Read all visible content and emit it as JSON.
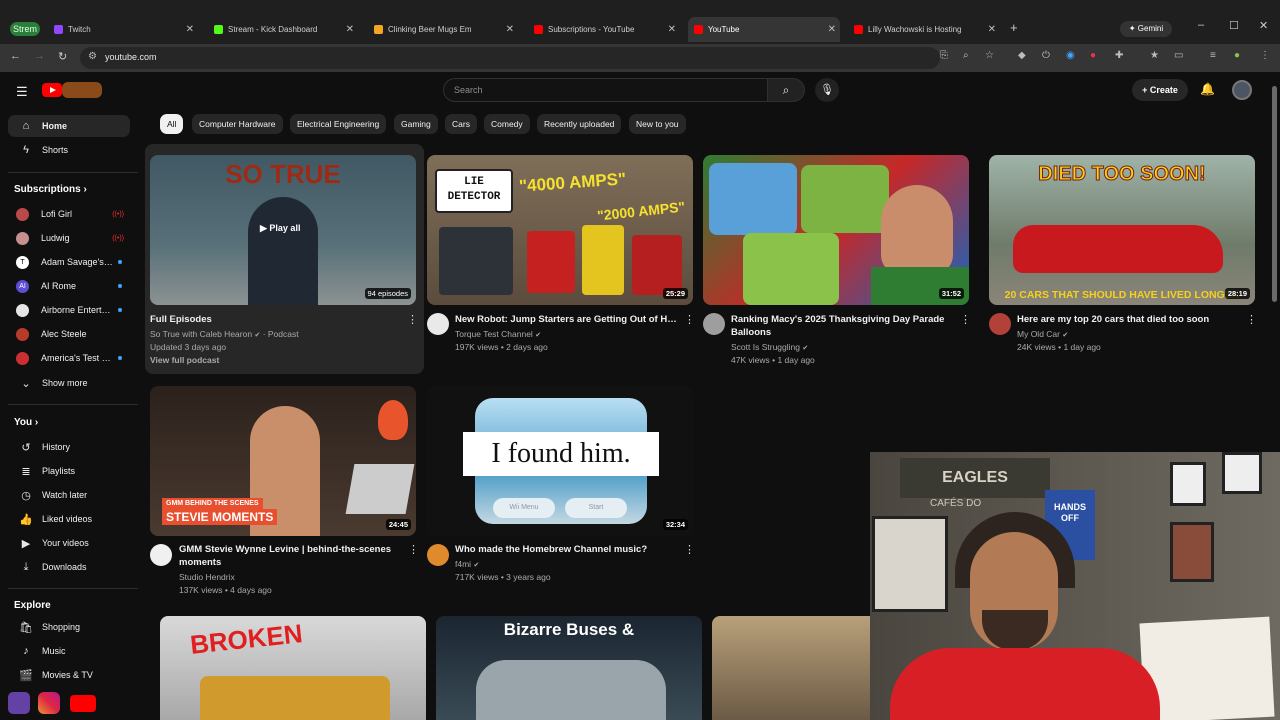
{
  "browser": {
    "stream_pill": "Strem",
    "tabs": [
      {
        "title": "Twitch",
        "favicon_color": "#9146ff"
      },
      {
        "title": "Stream - Kick Dashboard",
        "favicon_color": "#53fc18"
      },
      {
        "title": "Clinking Beer Mugs Em",
        "favicon_color": "#f6a623"
      },
      {
        "title": "Subscriptions - YouTube",
        "favicon_color": "#ff0000"
      },
      {
        "title": "YouTube",
        "favicon_color": "#ff0000",
        "active": true
      },
      {
        "title": "Lilly Wachowski is Hosting",
        "favicon_color": "#ff0000"
      }
    ],
    "gemini_label": "Gemini",
    "url": "youtube.com"
  },
  "header": {
    "search_placeholder": "Search",
    "create_label": "Create"
  },
  "sidebar": {
    "main": [
      {
        "label": "Home",
        "icon": "home-icon",
        "active": true
      },
      {
        "label": "Shorts",
        "icon": "shorts-icon"
      }
    ],
    "subscriptions_title": "Subscriptions",
    "subscriptions": [
      {
        "label": "Lofi Girl",
        "avatar_color": "#b94a48",
        "status": "live"
      },
      {
        "label": "Ludwig",
        "avatar_color": "#c88f8f",
        "status": "live"
      },
      {
        "label": "Adam Savage's T...",
        "avatar_color": "#ffffff",
        "avatar_letter": "T",
        "status": "new"
      },
      {
        "label": "AI Rome",
        "avatar_color": "#5b4fd6",
        "avatar_letter": "AI",
        "status": "new"
      },
      {
        "label": "Airborne Entertai...",
        "avatar_color": "#e5e5e5",
        "status": "new"
      },
      {
        "label": "Alec Steele",
        "avatar_color": "#b83a2b",
        "status": "none"
      },
      {
        "label": "America's Test Ki...",
        "avatar_color": "#cc2f2f",
        "status": "new"
      }
    ],
    "show_more": "Show more",
    "you_title": "You",
    "you_items": [
      {
        "label": "History",
        "icon": "history-icon"
      },
      {
        "label": "Playlists",
        "icon": "playlists-icon"
      },
      {
        "label": "Watch later",
        "icon": "watch-later-icon"
      },
      {
        "label": "Liked videos",
        "icon": "liked-icon"
      },
      {
        "label": "Your videos",
        "icon": "your-videos-icon"
      },
      {
        "label": "Downloads",
        "icon": "downloads-icon"
      }
    ],
    "explore_title": "Explore",
    "explore_items": [
      {
        "label": "Shopping",
        "icon": "shopping-icon"
      },
      {
        "label": "Music",
        "icon": "music-icon"
      },
      {
        "label": "Movies & TV",
        "icon": "movies-icon"
      }
    ]
  },
  "chips": [
    "All",
    "Computer Hardware",
    "Electrical Engineering",
    "Gaming",
    "Cars",
    "Comedy",
    "Recently uploaded",
    "New to you"
  ],
  "videos": [
    {
      "thumb_text": "SO TRUE",
      "overlay": "Play all",
      "episodes": "94 episodes",
      "title": "Full Episodes",
      "channel": "So True with Caleb Hearon",
      "channel_suffix": "· Podcast",
      "meta": "Updated 3 days ago",
      "extra": "View full podcast"
    },
    {
      "thumb_text_1": "LIE DETECTOR",
      "thumb_text_2": "\"4000 AMPS\"",
      "thumb_text_3": "\"2000 AMPS\"",
      "duration": "25:29",
      "title": "New Robot: Jump Starters are Getting Out of Hand",
      "channel": "Torque Test Channel",
      "meta": "197K views • 2 days ago"
    },
    {
      "duration": "31:52",
      "title": "Ranking Macy's 2025 Thanksgiving Day Parade Balloons",
      "channel": "Scott Is Struggling",
      "meta": "47K views • 1 day ago"
    },
    {
      "thumb_text_1": "DIED TOO SOON!",
      "thumb_text_2": "20 CARS THAT SHOULD HAVE LIVED LONGER",
      "duration": "28:19",
      "title": "Here are my top 20 cars that died too soon",
      "channel": "My Old Car",
      "meta": "24K views • 1 day ago"
    },
    {
      "thumb_text_1": "GMM BEHIND THE SCENES",
      "thumb_text_2": "STEVIE MOMENTS",
      "duration": "24:45",
      "title": "GMM Stevie Wynne Levine | behind-the-scenes moments",
      "channel": "Studio Hendrix",
      "meta": "137K views • 4 days ago"
    },
    {
      "thumb_text": "I found him.",
      "thumb_btn_1": "Wii Menu",
      "thumb_btn_2": "Start",
      "duration": "32:34",
      "title": "Who made the Homebrew Channel music?",
      "channel": "f4mi",
      "meta": "717K views • 3 years ago"
    }
  ],
  "bottom_row": [
    {
      "thumb_text": "BROKEN"
    },
    {
      "thumb_text": "Bizarre Buses &"
    },
    {
      "thumb_text": ""
    }
  ],
  "webcam": {
    "banner_1": "EAGLES",
    "banner_2": "CAFÉS DO",
    "sign": "HANDS OFF"
  }
}
